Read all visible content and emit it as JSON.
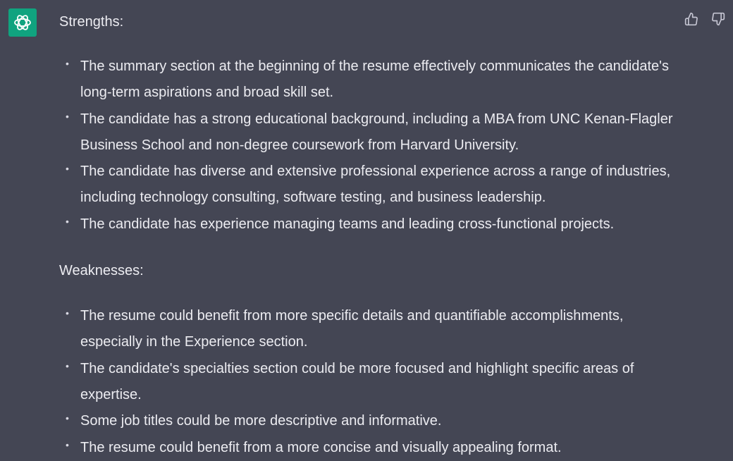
{
  "message": {
    "avatar_icon": "openai-logo-icon",
    "accent_color": "#10a37f",
    "feedback": {
      "thumbs_up_icon": "thumbs-up-icon",
      "thumbs_down_icon": "thumbs-down-icon"
    },
    "strengths": {
      "heading": "Strengths:",
      "items": [
        "The summary section at the beginning of the resume effectively communicates the candidate's long-term aspirations and broad skill set.",
        "The candidate has a strong educational background, including a MBA from UNC Kenan-Flagler Business School and non-degree coursework from Harvard University.",
        "The candidate has diverse and extensive professional experience across a range of industries, including technology consulting, software testing, and business leadership.",
        "The candidate has experience managing teams and leading cross-functional projects."
      ]
    },
    "weaknesses": {
      "heading": "Weaknesses:",
      "items": [
        "The resume could benefit from more specific details and quantifiable accomplishments, especially in the Experience section.",
        "The candidate's specialties section could be more focused and highlight specific areas of expertise.",
        "Some job titles could be more descriptive and informative.",
        "The resume could benefit from a more concise and visually appealing format."
      ]
    }
  }
}
